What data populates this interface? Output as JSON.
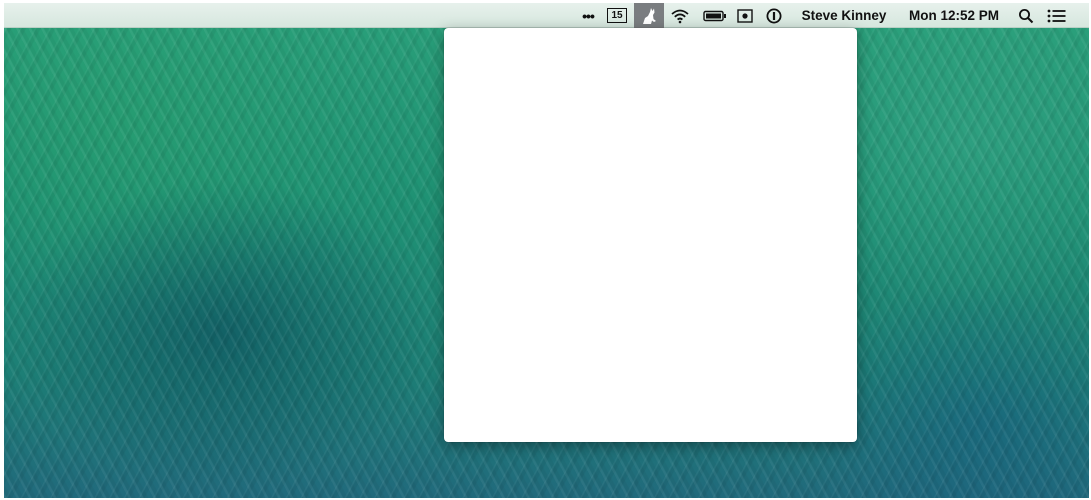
{
  "menubar": {
    "overflow_icon": "ellipsis-icon",
    "calendar_date": "15",
    "active_app_icon": "cat-icon",
    "wifi_icon": "wifi-icon",
    "battery_icon": "battery-icon",
    "screen_record_icon": "screen-record-icon",
    "password_icon": "info-circle-icon",
    "user_name": "Steve Kinney",
    "clock": "Mon 12:52 PM",
    "search_icon": "search-icon",
    "notifications_icon": "list-icon",
    "colors": {
      "bar": "#dbe9e1",
      "active_item_highlight": "#7a7d80"
    }
  },
  "desktop": {
    "wallpaper_colors": [
      "#2aa07a",
      "#1d7f76",
      "#216a7c"
    ]
  },
  "popover": {
    "background": "#ffffff",
    "content": ""
  }
}
